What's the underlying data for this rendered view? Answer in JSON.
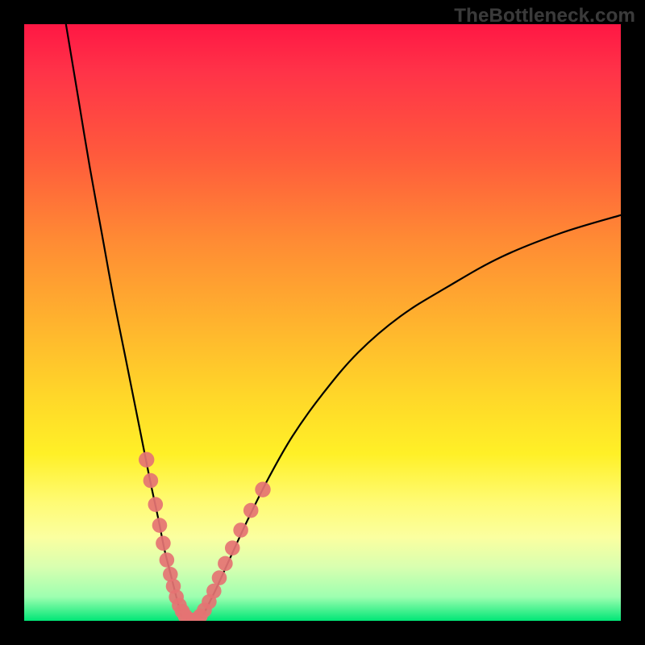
{
  "watermark": "TheBottleneck.com",
  "chart_data": {
    "type": "line",
    "title": "",
    "xlabel": "",
    "ylabel": "",
    "xlim": [
      0,
      100
    ],
    "ylim": [
      0,
      100
    ],
    "gradient_stops": [
      {
        "pos": 0.0,
        "color": "#ff1744"
      },
      {
        "pos": 0.08,
        "color": "#ff3348"
      },
      {
        "pos": 0.22,
        "color": "#ff5a3c"
      },
      {
        "pos": 0.36,
        "color": "#ff8a34"
      },
      {
        "pos": 0.5,
        "color": "#ffb32e"
      },
      {
        "pos": 0.62,
        "color": "#ffd629"
      },
      {
        "pos": 0.72,
        "color": "#fff027"
      },
      {
        "pos": 0.8,
        "color": "#fffb73"
      },
      {
        "pos": 0.86,
        "color": "#fbffa0"
      },
      {
        "pos": 0.91,
        "color": "#d8ffb0"
      },
      {
        "pos": 0.96,
        "color": "#9dffb0"
      },
      {
        "pos": 1.0,
        "color": "#00e676"
      }
    ],
    "series": [
      {
        "name": "left-branch",
        "x": [
          7.0,
          9.0,
          11.0,
          13.0,
          15.0,
          17.0,
          19.0,
          21.0,
          22.5,
          23.5,
          24.5,
          25.5,
          26.3
        ],
        "y": [
          100.0,
          88.0,
          76.0,
          65.0,
          54.0,
          44.0,
          34.0,
          24.0,
          17.0,
          12.0,
          8.0,
          4.0,
          1.0
        ]
      },
      {
        "name": "valley-floor",
        "x": [
          26.3,
          27.0,
          28.0,
          29.0,
          30.0
        ],
        "y": [
          1.0,
          0.2,
          0.0,
          0.2,
          1.0
        ]
      },
      {
        "name": "right-branch",
        "x": [
          30.0,
          32.0,
          34.5,
          37.5,
          41.0,
          45.0,
          50.0,
          56.0,
          63.0,
          71.0,
          80.0,
          90.0,
          100.0
        ],
        "y": [
          1.0,
          5.0,
          10.5,
          17.0,
          24.0,
          31.0,
          38.0,
          45.0,
          51.0,
          56.0,
          61.0,
          65.0,
          68.0
        ]
      }
    ],
    "scatter": {
      "name": "highlight-dots",
      "color": "#e57373",
      "points": [
        {
          "x": 20.5,
          "y": 27.0,
          "r": 1.4
        },
        {
          "x": 21.2,
          "y": 23.5,
          "r": 1.3
        },
        {
          "x": 22.0,
          "y": 19.5,
          "r": 1.3
        },
        {
          "x": 22.7,
          "y": 16.0,
          "r": 1.3
        },
        {
          "x": 23.3,
          "y": 13.0,
          "r": 1.3
        },
        {
          "x": 23.9,
          "y": 10.2,
          "r": 1.3
        },
        {
          "x": 24.5,
          "y": 7.8,
          "r": 1.3
        },
        {
          "x": 25.0,
          "y": 5.8,
          "r": 1.3
        },
        {
          "x": 25.5,
          "y": 4.0,
          "r": 1.3
        },
        {
          "x": 26.0,
          "y": 2.6,
          "r": 1.3
        },
        {
          "x": 26.5,
          "y": 1.6,
          "r": 1.3
        },
        {
          "x": 27.0,
          "y": 0.8,
          "r": 1.3
        },
        {
          "x": 27.5,
          "y": 0.3,
          "r": 1.3
        },
        {
          "x": 28.0,
          "y": 0.1,
          "r": 1.3
        },
        {
          "x": 28.5,
          "y": 0.1,
          "r": 1.3
        },
        {
          "x": 29.0,
          "y": 0.3,
          "r": 1.3
        },
        {
          "x": 29.5,
          "y": 0.8,
          "r": 1.3
        },
        {
          "x": 30.2,
          "y": 1.8,
          "r": 1.3
        },
        {
          "x": 31.0,
          "y": 3.2,
          "r": 1.3
        },
        {
          "x": 31.8,
          "y": 5.0,
          "r": 1.3
        },
        {
          "x": 32.7,
          "y": 7.2,
          "r": 1.3
        },
        {
          "x": 33.7,
          "y": 9.6,
          "r": 1.3
        },
        {
          "x": 34.9,
          "y": 12.2,
          "r": 1.3
        },
        {
          "x": 36.3,
          "y": 15.2,
          "r": 1.3
        },
        {
          "x": 38.0,
          "y": 18.5,
          "r": 1.3
        },
        {
          "x": 40.0,
          "y": 22.0,
          "r": 1.4
        }
      ]
    }
  }
}
